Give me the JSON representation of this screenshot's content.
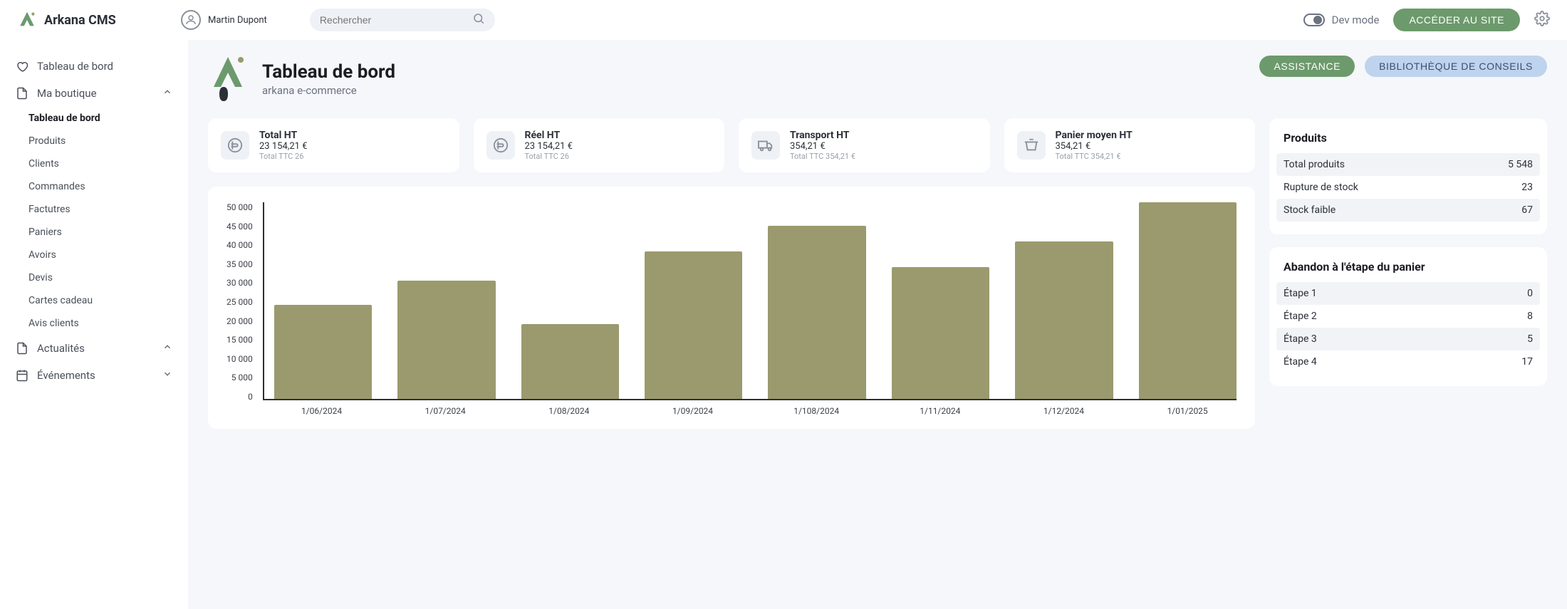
{
  "brand": "Arkana CMS",
  "user": {
    "name": "Martin Dupont"
  },
  "search": {
    "placeholder": "Rechercher"
  },
  "header": {
    "devmode_label": "Dev mode",
    "site_button": "ACCÉDER AU SITE"
  },
  "sidebar": {
    "dashboard": "Tableau de bord",
    "shop_label": "Ma boutique",
    "shop_items": [
      "Tableau de bord",
      "Produits",
      "Clients",
      "Commandes",
      "Factutres",
      "Paniers",
      "Avoirs",
      "Devis",
      "Cartes cadeau",
      "Avis clients"
    ],
    "news_label": "Actualités",
    "events_label": "Événements"
  },
  "page": {
    "title": "Tableau de bord",
    "subtitle": "arkana e-commerce",
    "assist_button": "ASSISTANCE",
    "advice_button": "BIBLIOTHÈQUE DE CONSEILS"
  },
  "stats": [
    {
      "title": "Total HT",
      "value": "23 154,21 €",
      "sub": "Total TTC 26"
    },
    {
      "title": "Réel HT",
      "value": "23 154,21 €",
      "sub": "Total TTC 26"
    },
    {
      "title": "Transport HT",
      "value": "354,21 €",
      "sub": "Total TTC 354,21 €"
    },
    {
      "title": "Panier moyen HT",
      "value": "354,21 €",
      "sub": "Total TTC 354,21 €"
    }
  ],
  "chart_data": {
    "type": "bar",
    "categories": [
      "1/06/2024",
      "1/07/2024",
      "1/08/2024",
      "1/09/2024",
      "1/108/2024",
      "1/11/2024",
      "1/12/2024",
      "1/01/2025"
    ],
    "values": [
      24000,
      30000,
      19000,
      37500,
      44000,
      33500,
      40000,
      50000
    ],
    "ylim": [
      0,
      50000
    ],
    "yticks": [
      "50 000",
      "45 000",
      "40 000",
      "35 000",
      "30 000",
      "25 000",
      "20 000",
      "15 000",
      "10 000",
      "5 000",
      "0"
    ]
  },
  "products_panel": {
    "title": "Produits",
    "rows": [
      {
        "label": "Total produits",
        "value": "5 548"
      },
      {
        "label": "Rupture de stock",
        "value": "23"
      },
      {
        "label": "Stock faible",
        "value": "67"
      }
    ]
  },
  "cart_panel": {
    "title": "Abandon à l'étape du panier",
    "rows": [
      {
        "label": "Étape 1",
        "value": "0"
      },
      {
        "label": "Étape 2",
        "value": "8"
      },
      {
        "label": "Étape 3",
        "value": "5"
      },
      {
        "label": "Étape 4",
        "value": "17"
      }
    ]
  }
}
